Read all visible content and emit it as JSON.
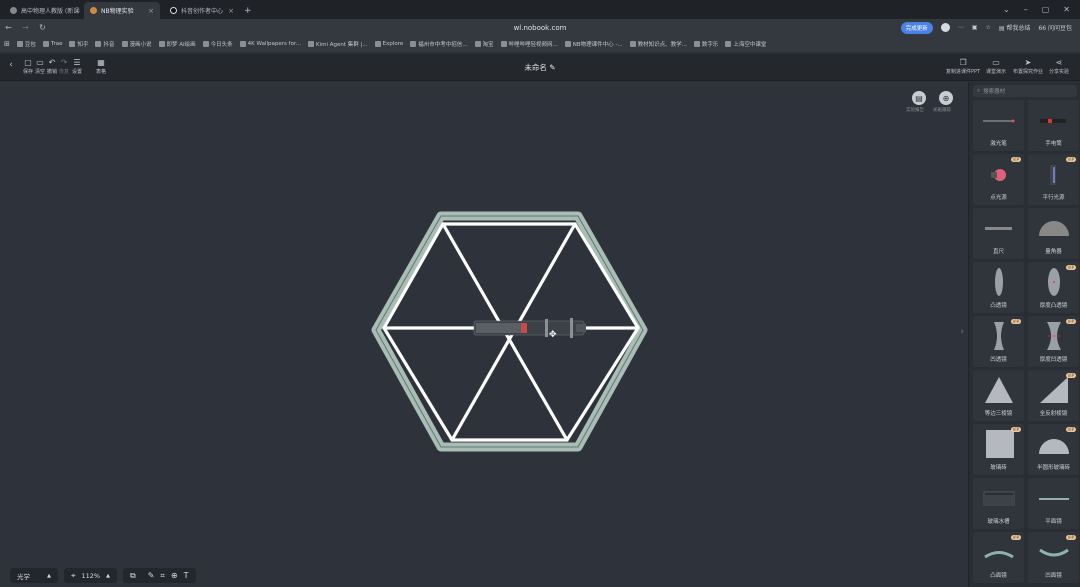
{
  "tabs": [
    {
      "label": "高中物理人教版 (新课标)",
      "active": false
    },
    {
      "label": "NB物理实验",
      "active": true
    },
    {
      "label": "抖音创作者中心",
      "active": false
    }
  ],
  "address": {
    "url": "wl.nobook.com",
    "update_label": "完成更新",
    "bookmark_label": "帮我总结",
    "ai_label": "问问豆包"
  },
  "bookmarks": [
    "豆包",
    "Trae",
    "知乎",
    "抖音",
    "漫画小说",
    "即梦 AI绘画",
    "今日头条",
    "4K Wallpapers for...",
    "Kimi Agent 集群 |...",
    "Explore",
    "福州市中考中招信...",
    "淘宝",
    "哔哩哔哩轻视频网...",
    "NB物理课件中心 -...",
    "教材知识点、教学...",
    "数字乐",
    "上海空中课堂"
  ],
  "toolbar": {
    "left": [
      {
        "label": "保存",
        "icon": "save-icon"
      },
      {
        "label": "清空",
        "icon": "trash-icon"
      },
      {
        "label": "撤销",
        "icon": "undo-icon"
      },
      {
        "label": "恢复",
        "icon": "redo-icon"
      },
      {
        "label": "设置",
        "icon": "settings-icon"
      },
      {
        "label": "表格",
        "icon": "table-icon"
      }
    ],
    "title": "未命名",
    "right": [
      {
        "label": "复制进课件PPT"
      },
      {
        "label": "课堂演示"
      },
      {
        "label": "布置探究作业"
      },
      {
        "label": "分享实验"
      }
    ]
  },
  "canvas": {
    "fab_report": "实验报告",
    "fab_pointer": "光斑跟踪",
    "mode": "光学",
    "zoom": "112%"
  },
  "sidebar": {
    "search_placeholder": "搜索器材",
    "items": [
      {
        "label": "激光笔",
        "vip": false
      },
      {
        "label": "手电筒",
        "vip": false
      },
      {
        "label": "点光源",
        "vip": true
      },
      {
        "label": "平行光源",
        "vip": true
      },
      {
        "label": "直尺",
        "vip": false
      },
      {
        "label": "量角器",
        "vip": false
      },
      {
        "label": "凸透镜",
        "vip": false
      },
      {
        "label": "厚度凸透镜",
        "vip": true
      },
      {
        "label": "凹透镜",
        "vip": true
      },
      {
        "label": "厚度凹透镜",
        "vip": true
      },
      {
        "label": "等边三棱镜",
        "vip": false
      },
      {
        "label": "全反射棱镜",
        "vip": true
      },
      {
        "label": "玻璃砖",
        "vip": true
      },
      {
        "label": "半圆形玻璃砖",
        "vip": true
      },
      {
        "label": "玻璃水槽",
        "vip": false
      },
      {
        "label": "平面镜",
        "vip": false
      },
      {
        "label": "凸面镜",
        "vip": true
      },
      {
        "label": "凹面镜",
        "vip": true
      }
    ],
    "vip_label": "VIP"
  },
  "colors": {
    "canvas_bg": "#2e323a",
    "hex_glass": "#a9bdb6",
    "accent": "#4a82e6"
  }
}
